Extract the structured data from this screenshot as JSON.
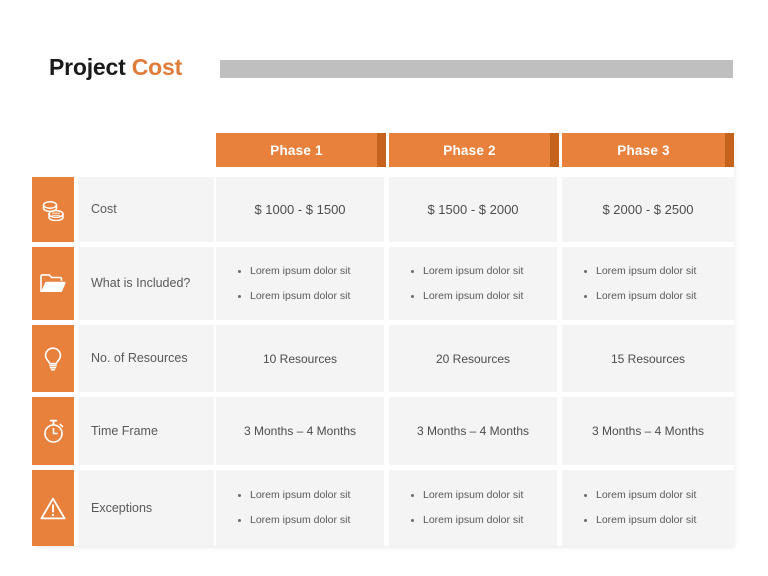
{
  "title": {
    "main": "Project ",
    "accent": "Cost",
    "bar_color": "#BFBFBF"
  },
  "theme": {
    "orange": "#E8813C",
    "orange_dark": "#C4621E",
    "cell_bg": "#F4F4F4",
    "text": "#59595B"
  },
  "columns": [
    {
      "label": "Phase 1"
    },
    {
      "label": "Phase 2"
    },
    {
      "label": "Phase 3"
    }
  ],
  "rows": [
    {
      "icon": "coins-icon",
      "label": "Cost",
      "type": "value",
      "cells": [
        "$ 1000 - $ 1500",
        "$ 1500 - $ 2000",
        "$ 2000 - $ 2500"
      ]
    },
    {
      "icon": "folder-icon",
      "label": "What is Included?",
      "type": "bullets",
      "cells": [
        [
          "Lorem ipsum dolor sit",
          "Lorem ipsum dolor sit"
        ],
        [
          "Lorem ipsum dolor sit",
          "Lorem ipsum dolor sit"
        ],
        [
          "Lorem ipsum dolor sit",
          "Lorem ipsum dolor sit"
        ]
      ]
    },
    {
      "icon": "lightbulb-icon",
      "label": "No. of Resources",
      "type": "value",
      "cells": [
        "10 Resources",
        "20 Resources",
        "15 Resources"
      ]
    },
    {
      "icon": "stopwatch-icon",
      "label": "Time Frame",
      "type": "value",
      "cells": [
        "3 Months – 4 Months",
        "3 Months – 4 Months",
        "3 Months – 4 Months"
      ]
    },
    {
      "icon": "warning-icon",
      "label": "Exceptions",
      "type": "bullets",
      "cells": [
        [
          "Lorem ipsum dolor sit",
          "Lorem ipsum dolor sit"
        ],
        [
          "Lorem ipsum dolor sit",
          "Lorem ipsum dolor sit"
        ],
        [
          "Lorem ipsum dolor sit",
          "Lorem ipsum dolor sit"
        ]
      ]
    }
  ]
}
